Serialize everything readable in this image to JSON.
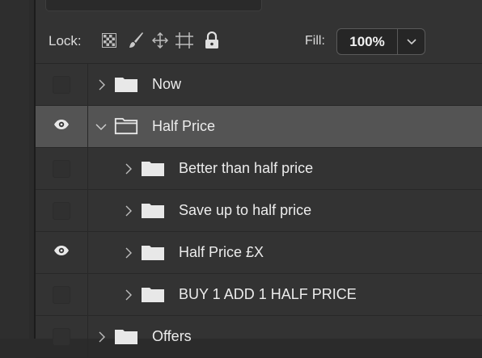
{
  "lock_bar": {
    "lock_label": "Lock:",
    "fill_label": "Fill:",
    "fill_value": "100%"
  },
  "layers": [
    {
      "name": "Now",
      "visible": false,
      "expanded": false,
      "type": "folder",
      "depth": 0,
      "selected": false
    },
    {
      "name": "Half Price",
      "visible": true,
      "expanded": true,
      "type": "folder",
      "depth": 0,
      "selected": true
    },
    {
      "name": "Better than half price",
      "visible": false,
      "expanded": false,
      "type": "folder",
      "depth": 1,
      "selected": false
    },
    {
      "name": "Save up to half price",
      "visible": false,
      "expanded": false,
      "type": "folder",
      "depth": 1,
      "selected": false
    },
    {
      "name": "Half Price £X",
      "visible": true,
      "expanded": false,
      "type": "folder",
      "depth": 1,
      "selected": false
    },
    {
      "name": "BUY 1 ADD 1 HALF PRICE",
      "visible": false,
      "expanded": false,
      "type": "folder",
      "depth": 1,
      "selected": false
    },
    {
      "name": "Offers",
      "visible": false,
      "expanded": false,
      "type": "folder",
      "depth": 0,
      "selected": false
    }
  ],
  "colors": {
    "panel_bg": "#333333",
    "selected_row_bg": "#545454",
    "text": "#ececec"
  }
}
